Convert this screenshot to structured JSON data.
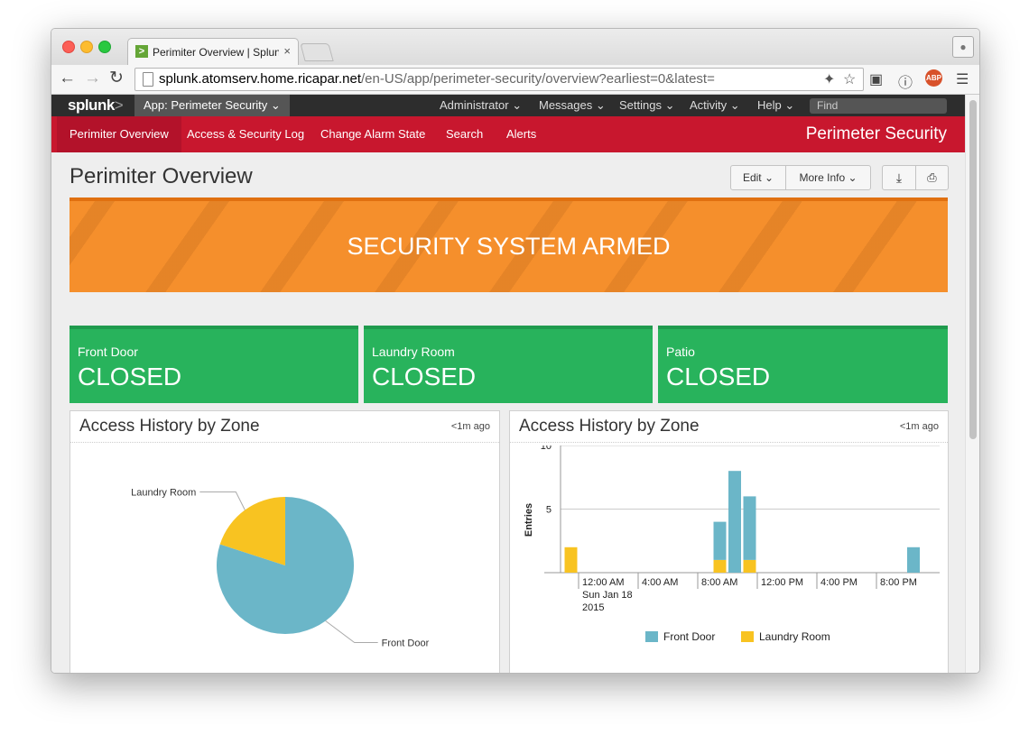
{
  "browser": {
    "tab_title": "Perimiter Overview | Splunk",
    "tab_favicon": ">",
    "tab_close": "×",
    "url_host": "splunk.atomserv.home.ricapar.net",
    "url_path": "/en-US/app/perimeter-security/overview?earliest=0&latest=",
    "extension_label": "ABP"
  },
  "appbar": {
    "logo": "splunk",
    "logo_suffix": ">",
    "app_label": "App: Perimeter Security",
    "menus": [
      "Administrator",
      "Messages",
      "Settings",
      "Activity",
      "Help"
    ],
    "find_placeholder": "Find"
  },
  "nav": {
    "items": [
      "Perimiter Overview",
      "Access & Security Log",
      "Change Alarm State",
      "Search",
      "Alerts"
    ],
    "brand": "Perimeter Security"
  },
  "page": {
    "title": "Perimiter Overview",
    "edit_label": "Edit",
    "more_info_label": "More Info"
  },
  "banner": {
    "text": "SECURITY SYSTEM ARMED"
  },
  "zones": [
    {
      "name": "Front Door",
      "status": "CLOSED"
    },
    {
      "name": "Laundry Room",
      "status": "CLOSED"
    },
    {
      "name": "Patio",
      "status": "CLOSED"
    }
  ],
  "colors": {
    "front_door": "#6bb6c8",
    "laundry_room": "#f8c321",
    "nav_red": "#c8172e",
    "banner_orange": "#f58f2c",
    "zone_green": "#28b35c"
  },
  "panels": [
    {
      "title": "Access History by Zone",
      "time": "<1m ago"
    },
    {
      "title": "Access History by Zone",
      "time": "<1m ago"
    }
  ],
  "chart_data": [
    {
      "type": "pie",
      "categories": [
        "Front Door",
        "Laundry Room"
      ],
      "values": [
        0.8,
        0.2
      ],
      "labels": [
        "Front Door",
        "Laundry Room"
      ]
    },
    {
      "type": "bar",
      "stacked": true,
      "ylabel": "Entries",
      "ylim": [
        0,
        10
      ],
      "yticks": [
        5,
        10
      ],
      "xticks": [
        "12:00 AM",
        "4:00 AM",
        "8:00 AM",
        "12:00 PM",
        "4:00 PM",
        "8:00 PM"
      ],
      "xtick_sub": [
        "Sun Jan 18",
        "2015"
      ],
      "bins_hours": [
        -1,
        9,
        10,
        11,
        22
      ],
      "series": [
        {
          "name": "Front Door",
          "values": [
            0,
            3,
            8,
            5,
            2
          ]
        },
        {
          "name": "Laundry Room",
          "values": [
            2,
            1,
            0,
            1,
            0
          ]
        }
      ],
      "legend": "bottom"
    }
  ]
}
